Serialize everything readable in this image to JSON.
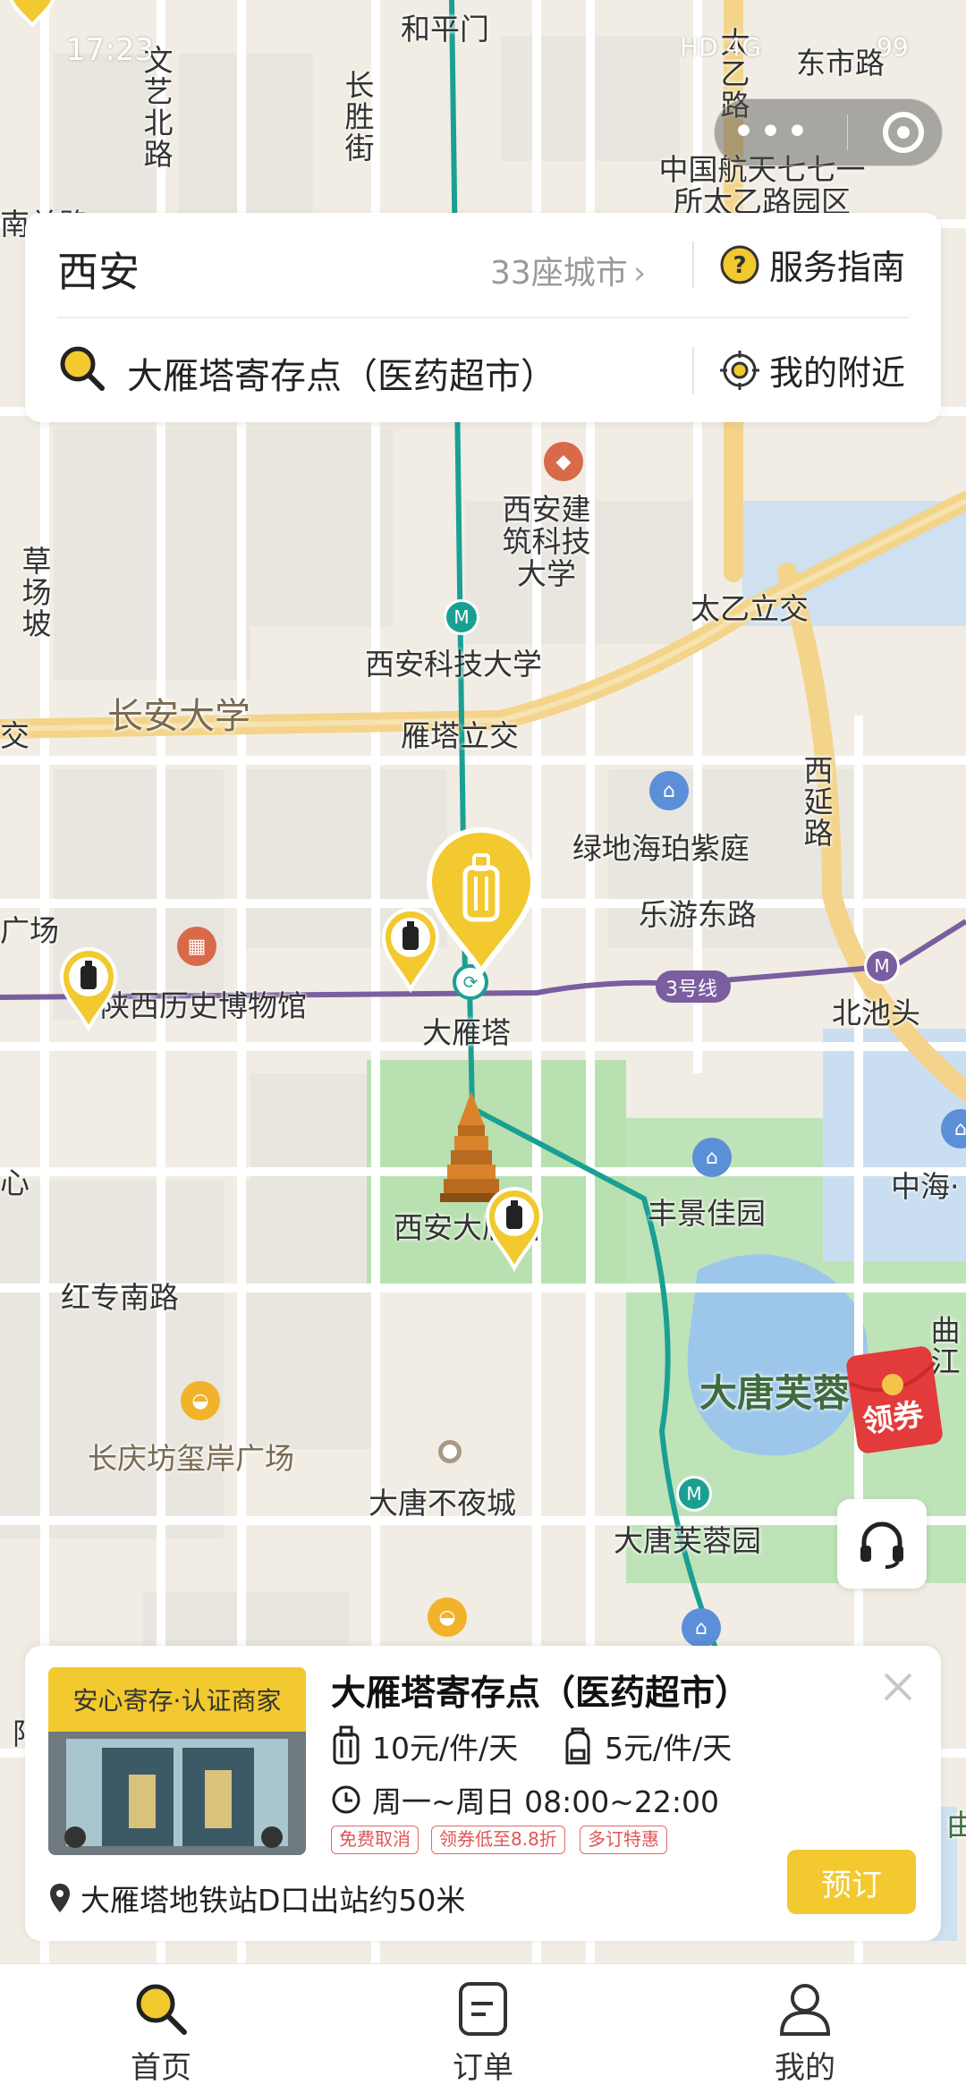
{
  "colors": {
    "accent": "#f2c92e",
    "metro_line2": "#1aa093",
    "metro_line3": "#7a5ea0",
    "coupon_red": "#e33b3b"
  },
  "status_bar": {
    "time": "17:23",
    "network": "HD 4G",
    "battery": "99"
  },
  "top_panel": {
    "city": "西安",
    "city_count": "33座城市",
    "guide_label": "服务指南",
    "search_text": "大雁塔寄存点（医药超市）",
    "nearby_label": "我的附近"
  },
  "map_labels": {
    "heping_gate": "和平门",
    "dongshi_road": "东市路",
    "wenyi_north_road": "文艺北路",
    "changsheng_street": "长胜街",
    "taiyi_road": "太乙路",
    "cast_area": "中国航天七七一所太乙路园区",
    "nanguan": "南关路",
    "xauat": "西安建筑科技大学",
    "caochang_slope": "草场坡",
    "taiyi_interchange": "太乙立交",
    "xust": "西安科技大学",
    "changan_univ": "长安大学",
    "yanta_interchange": "雁塔立交",
    "jiao": "交",
    "xiyan_road": "西延路",
    "lvdi": "绿地海珀紫庭",
    "leyou_east": "乐游东路",
    "guangchang": "广场",
    "museum": "陕西历史博物馆",
    "line3_badge": "3号线",
    "beichitou": "北池头",
    "dayanta_station": "大雁塔",
    "dayanta_park": "西安大雁塔",
    "fengjing": "丰景佳园",
    "zhonghai": "中海·",
    "xin": "心",
    "hongzhuan_south": "红专南路",
    "qujiang": "曲江",
    "tang_paradise": "大唐芙蓉",
    "changqingfang": "长庆坊玺岸广场",
    "datang_everbright": "大唐不夜城",
    "tang_paradise_station": "大唐芙蓉园",
    "yang": "阳",
    "you": "由"
  },
  "coupon_label": "领券",
  "card": {
    "badge": "安心寄存·认证商家",
    "title": "大雁塔寄存点（医药超市）",
    "price_luggage": "10元/件/天",
    "price_bag": "5元/件/天",
    "hours": "周一~周日 08:00~22:00",
    "tags": [
      "免费取消",
      "领券低至8.8折",
      "多订特惠"
    ],
    "address": "大雁塔地铁站D口出站约50米",
    "book_label": "预订"
  },
  "tabs": [
    {
      "label": "首页",
      "icon": "search-icon",
      "active": true
    },
    {
      "label": "订单",
      "icon": "order-icon",
      "active": false
    },
    {
      "label": "我的",
      "icon": "person-icon",
      "active": false
    }
  ]
}
